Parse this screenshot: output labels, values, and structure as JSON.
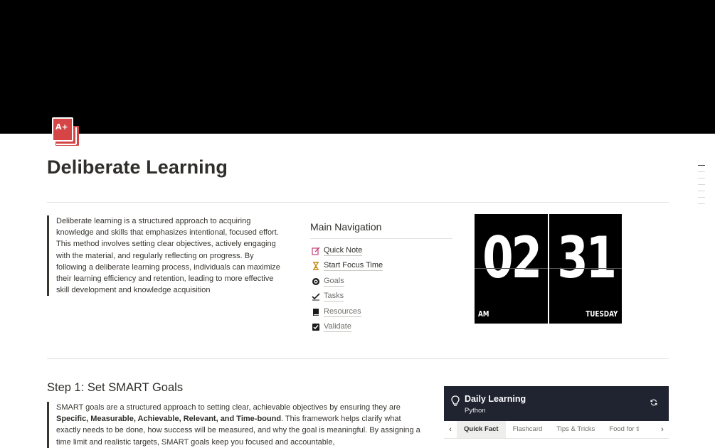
{
  "page": {
    "title": "Deliberate Learning",
    "icon": "a-plus-book-icon"
  },
  "intro": {
    "text": "Deliberate learning is a structured approach to acquiring knowledge and skills that emphasizes intentional, focused effort. This method involves setting clear objectives, actively engaging with the material, and regularly reflecting on progress. By following a deliberate learning process, individuals can maximize their learning efficiency and retention, leading to more effective skill development and knowledge acquisition"
  },
  "navigation": {
    "heading": "Main Navigation",
    "items": [
      {
        "label": "Quick Note",
        "icon": "pencil-square-icon"
      },
      {
        "label": "Start Focus Time",
        "icon": "hourglass-icon"
      },
      {
        "label": "Goals",
        "icon": "target-icon"
      },
      {
        "label": "Tasks",
        "icon": "checkmark-icon"
      },
      {
        "label": "Resources",
        "icon": "book-icon"
      },
      {
        "label": "Validate",
        "icon": "checkbox-icon"
      }
    ]
  },
  "clock": {
    "hours": "02",
    "minutes": "31",
    "period": "AM",
    "weekday": "TUESDAY"
  },
  "step1": {
    "heading": "Step 1: Set SMART Goals",
    "text_before": "SMART goals are a structured approach to setting clear, achievable objectives by ensuring they are ",
    "text_bold": "Specific, Measurable, Achievable, Relevant, and Time-bound",
    "text_after": ". This framework helps clarify what exactly needs to be done, how success will be measured, and why the goal is meaningful. By assigning a time limit and realistic targets, SMART goals keep you focused and accountable,"
  },
  "daily_learning": {
    "title": "Daily Learning",
    "subtitle": "Python",
    "tabs": [
      "Quick Fact",
      "Flashcard",
      "Tips & Tricks",
      "Food for thought"
    ],
    "active_tab": "Quick Fact"
  },
  "colors": {
    "cover": "#000000",
    "icon_red": "#d64545",
    "widget_header": "#1f2430"
  }
}
